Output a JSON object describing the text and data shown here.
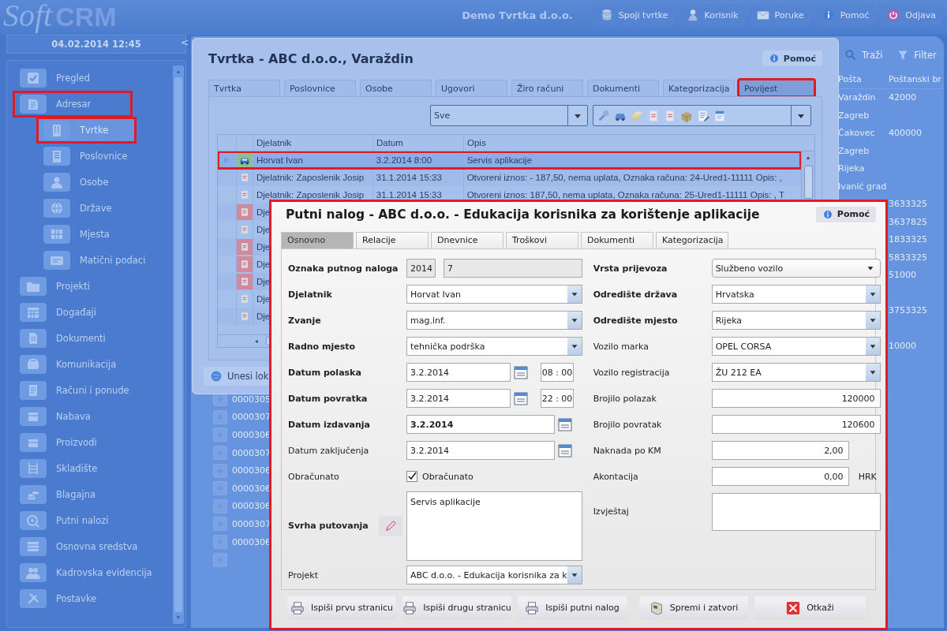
{
  "header": {
    "logo_left": "Soft",
    "logo_right": "CRM",
    "company": "Demo Tvrtka d.o.o.",
    "actions": [
      {
        "label": "Spoji tvrtke",
        "kind": "merge"
      },
      {
        "label": "Korisnik",
        "kind": "user"
      },
      {
        "label": "Poruke",
        "kind": "messages"
      },
      {
        "label": "Pomoć",
        "kind": "help"
      },
      {
        "label": "Odjava",
        "kind": "logout"
      }
    ]
  },
  "sidebar": {
    "datetime": "04.02.2014 12:45",
    "collapse": "<",
    "items": [
      {
        "label": "Pregled",
        "kind": "overview",
        "selected": false,
        "highlighted": false
      },
      {
        "label": "Adresar",
        "kind": "contacts",
        "selected": false,
        "highlighted": true,
        "children": [
          {
            "label": "Tvrtke",
            "kind": "company",
            "selected": true,
            "highlighted": true
          },
          {
            "label": "Poslovnice",
            "kind": "branch",
            "selected": false,
            "highlighted": false
          },
          {
            "label": "Osobe",
            "kind": "person",
            "selected": false,
            "highlighted": false
          },
          {
            "label": "Države",
            "kind": "country",
            "selected": false,
            "highlighted": false
          },
          {
            "label": "Mjesta",
            "kind": "place",
            "selected": false,
            "highlighted": false
          },
          {
            "label": "Matični podaci",
            "kind": "masterdata",
            "selected": false,
            "highlighted": false
          }
        ]
      },
      {
        "label": "Projekti",
        "kind": "projects",
        "selected": false,
        "highlighted": false
      },
      {
        "label": "Događaji",
        "kind": "events",
        "selected": false,
        "highlighted": false
      },
      {
        "label": "Dokumenti",
        "kind": "documents",
        "selected": false,
        "highlighted": false
      },
      {
        "label": "Komunikacija",
        "kind": "communication",
        "selected": false,
        "highlighted": false
      },
      {
        "label": "Računi i ponude",
        "kind": "invoices",
        "selected": false,
        "highlighted": false
      },
      {
        "label": "Nabava",
        "kind": "procurement",
        "selected": false,
        "highlighted": false
      },
      {
        "label": "Proizvodi",
        "kind": "products",
        "selected": false,
        "highlighted": false
      },
      {
        "label": "Skladište",
        "kind": "warehouse",
        "selected": false,
        "highlighted": false
      },
      {
        "label": "Blagajna",
        "kind": "cash",
        "selected": false,
        "highlighted": false
      },
      {
        "label": "Putni nalozi",
        "kind": "travel",
        "selected": false,
        "highlighted": false
      },
      {
        "label": "Osnovna sredstva",
        "kind": "assets",
        "selected": false,
        "highlighted": false
      },
      {
        "label": "Kadrovska evidencija",
        "kind": "hr",
        "selected": false,
        "highlighted": false
      },
      {
        "label": "Postavke",
        "kind": "settings",
        "selected": false,
        "highlighted": false
      }
    ]
  },
  "background_list": {
    "toolbar": [
      {
        "label": "Traži",
        "kind": "search"
      },
      {
        "label": "Filter",
        "kind": "filter"
      }
    ],
    "columns": [
      "Pošta",
      "Poštanski br"
    ],
    "rows": [
      [
        "Varaždin",
        "42000"
      ],
      [
        "Zagreb",
        null
      ],
      [
        "Čakovec",
        "400000"
      ],
      [
        "Zagreb",
        null
      ],
      [
        "Rijeka",
        null
      ],
      [
        "Ivanić grad",
        null
      ],
      [
        null,
        "3633325"
      ],
      [
        null,
        "3637825"
      ],
      [
        null,
        "1833325"
      ],
      [
        null,
        "5833325"
      ],
      [
        null,
        "51000"
      ],
      [
        null,
        null
      ],
      [
        null,
        "3753325"
      ],
      [
        null,
        null
      ],
      [
        null,
        "10000"
      ]
    ],
    "codes": [
      "0000305",
      "0000307",
      "0000306",
      "0000307",
      "0000306",
      "0000306",
      "0000306",
      "0000307",
      "0000306"
    ],
    "trailing_add_button": true
  },
  "company_window": {
    "title": "Tvrtka - ABC d.o.o., Varaždin",
    "help": "Pomoć",
    "tabs": [
      {
        "label": "Tvrtka",
        "selected": false,
        "highlighted": false
      },
      {
        "label": "Poslovnice",
        "selected": false,
        "highlighted": false
      },
      {
        "label": "Osobe",
        "selected": false,
        "highlighted": false
      },
      {
        "label": "Ugovori",
        "selected": false,
        "highlighted": false
      },
      {
        "label": "Žiro računi",
        "selected": false,
        "highlighted": false
      },
      {
        "label": "Dokumenti",
        "selected": false,
        "highlighted": false
      },
      {
        "label": "Kategorizacija",
        "selected": false,
        "highlighted": false
      },
      {
        "label": "Povijest",
        "selected": true,
        "highlighted": true
      }
    ],
    "filter": "Sve",
    "grid": {
      "columns": [
        "Djelatnik",
        "Datum",
        "Opis"
      ],
      "rows": [
        {
          "kind": "trip",
          "selected": true,
          "highlighted": true,
          "flagged": false,
          "cells": [
            "Horvat Ivan",
            "3.2.2014 8:00",
            "Servis aplikacije"
          ]
        },
        {
          "kind": "invoice",
          "selected": false,
          "highlighted": false,
          "flagged": false,
          "cells": [
            "Djelatnik: Zaposlenik Josip",
            "31.1.2014 15:33",
            "Otvoreni iznos: - 187,50, nema uplata,  Oznaka računa: 24-Ured1-11111 Opis: ,"
          ]
        },
        {
          "kind": "invoice",
          "selected": false,
          "highlighted": false,
          "flagged": false,
          "cells": [
            "Djelatnik: Zaposlenik Josip",
            "31.1.2014 15:33",
            "Otvoreni iznos: 187,50, nema uplata,  Oznaka računa: 25-Ured1-11111 Opis: , T"
          ]
        },
        {
          "kind": "invoice",
          "selected": false,
          "highlighted": false,
          "flagged": true,
          "cells": [
            "Dje"
          ]
        },
        {
          "kind": "invoice",
          "selected": false,
          "highlighted": false,
          "flagged": false,
          "cells": [
            "Dje"
          ]
        },
        {
          "kind": "invoice",
          "selected": false,
          "highlighted": false,
          "flagged": true,
          "cells": [
            "Dje"
          ]
        },
        {
          "kind": "invoice",
          "selected": false,
          "highlighted": false,
          "flagged": true,
          "cells": [
            "Dje"
          ]
        },
        {
          "kind": "invoice",
          "selected": false,
          "highlighted": false,
          "flagged": true,
          "cells": [
            "Dje"
          ]
        },
        {
          "kind": "invoice",
          "selected": false,
          "highlighted": false,
          "flagged": false,
          "cells": [
            "Dje"
          ]
        },
        {
          "kind": "invoice",
          "selected": false,
          "highlighted": false,
          "flagged": false,
          "cells": [
            "Dje"
          ]
        }
      ]
    },
    "footer_button": "Unesi lok"
  },
  "travel_order_dialog": {
    "title": "Putni nalog - ABC d.o.o. - Edukacija korisnika za korištenje aplikacije",
    "help": "Pomoć",
    "highlighted": true,
    "tabs": [
      {
        "label": "Osnovno",
        "selected": true
      },
      {
        "label": "Relacije",
        "selected": false
      },
      {
        "label": "Dnevnice",
        "selected": false
      },
      {
        "label": "Troškovi",
        "selected": false
      },
      {
        "label": "Dokumenti",
        "selected": false
      },
      {
        "label": "Kategorizacija",
        "selected": false
      }
    ],
    "left_fields": [
      {
        "kind": "pair",
        "label": "Oznaka putnog naloga",
        "required": true,
        "disabled": true,
        "values": [
          "2014",
          "7"
        ]
      },
      {
        "kind": "dropdown",
        "label": "Djelatnik",
        "required": true,
        "value": "Horvat Ivan"
      },
      {
        "kind": "dropdown",
        "label": "Zvanje",
        "required": true,
        "value": "mag.inf."
      },
      {
        "kind": "dropdown",
        "label": "Radno mjesto",
        "required": true,
        "value": "tehnička podrška"
      },
      {
        "kind": "datetime",
        "label": "Datum polaska",
        "required": true,
        "value": "3.2.2014",
        "time": "08 : 00"
      },
      {
        "kind": "datetime",
        "label": "Datum povratka",
        "required": true,
        "value": "3.2.2014",
        "time": "22 : 00"
      },
      {
        "kind": "date",
        "label": "Datum izdavanja",
        "required": true,
        "bold_value": true,
        "value": "3.2.2014"
      },
      {
        "kind": "date",
        "label": "Datum zaključenja",
        "required": false,
        "bold_value": false,
        "value": "3.2.2014"
      },
      {
        "kind": "checkbox",
        "label": "Obračunato",
        "required": false,
        "checked": true,
        "text": "Obračunato"
      },
      {
        "kind": "textarea",
        "label": "Svrha putovanja",
        "required": true,
        "editable": true,
        "value": "Servis aplikacije"
      },
      {
        "kind": "dropdown",
        "label": "Projekt",
        "required": false,
        "value": "ABC d.o.o. - Edukacija korisnika za k"
      }
    ],
    "right_fields": [
      {
        "kind": "select",
        "label": "Vrsta prijevoza",
        "required": true,
        "value": "Službeno vozilo"
      },
      {
        "kind": "dropdown",
        "label": "Odredište država",
        "required": true,
        "value": "Hrvatska"
      },
      {
        "kind": "dropdown",
        "label": "Odredište mjesto",
        "required": true,
        "value": "Rijeka"
      },
      {
        "kind": "dropdown",
        "label": "Vozilo marka",
        "required": false,
        "value": "OPEL CORSA"
      },
      {
        "kind": "dropdown",
        "label": "Vozilo registracija",
        "required": false,
        "value": "ŽU 212 EA"
      },
      {
        "kind": "number",
        "label": "Brojilo polazak",
        "required": false,
        "value": "120000"
      },
      {
        "kind": "number",
        "label": "Brojilo povratak",
        "required": false,
        "value": "120600"
      },
      {
        "kind": "amount",
        "label": "Naknada po KM",
        "required": false,
        "value": "2,00"
      },
      {
        "kind": "amount",
        "label": "Akontacija",
        "required": false,
        "value": "0,00",
        "unit": "HRK"
      },
      {
        "kind": "textarea",
        "label": "Izvještaj",
        "required": false,
        "editable": false
      }
    ],
    "buttons": [
      {
        "label": "Ispiši prvu stranicu",
        "kind": "print"
      },
      {
        "label": "Ispiši drugu stranicu",
        "kind": "print"
      },
      {
        "label": "Ispiši putni nalog",
        "kind": "print"
      },
      {
        "label": "Spremi i zatvori",
        "kind": "save"
      },
      {
        "label": "Otkaži",
        "kind": "cancel"
      }
    ]
  }
}
